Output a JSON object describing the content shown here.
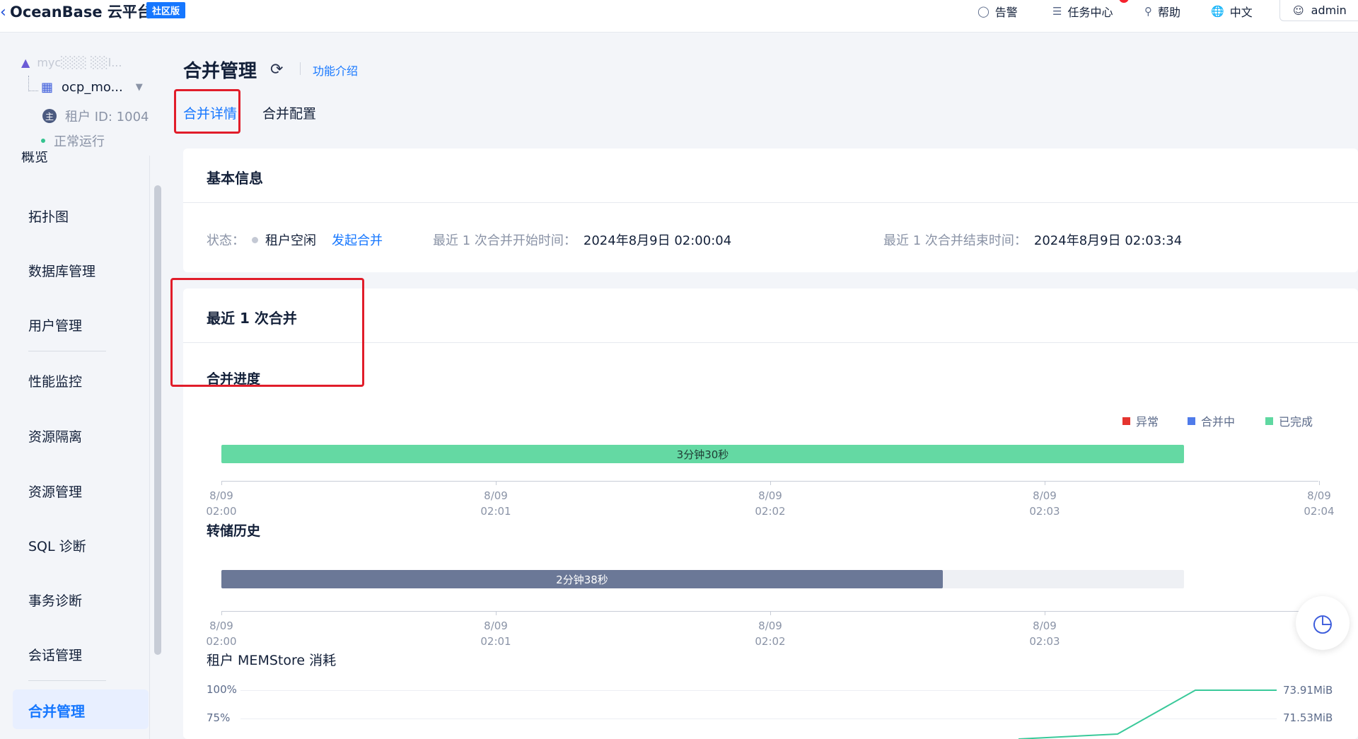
{
  "topbar": {
    "brand": "OceanBase 云平台",
    "edition": "社区版",
    "alerts": "告警",
    "tasks": "任务中心",
    "help": "帮助",
    "language": "中文",
    "user": "admin"
  },
  "context": {
    "cluster": "myc░░░ ░░l...",
    "tenant": "ocp_mo...",
    "tenant_id": "租户 ID: 1004",
    "status": "正常运行"
  },
  "sidebar": {
    "items": [
      "概览",
      "拓扑图",
      "数据库管理",
      "用户管理",
      "性能监控",
      "资源隔离",
      "资源管理",
      "SQL 诊断",
      "事务诊断",
      "会话管理",
      "合并管理"
    ],
    "active": "合并管理"
  },
  "page": {
    "title": "合并管理",
    "intro_link": "功能介绍",
    "tabs": [
      "合并详情",
      "合并配置"
    ]
  },
  "basic_info": {
    "title": "基本信息",
    "status_label": "状态：",
    "status_value": "租户空闲",
    "action": "发起合并",
    "last_start_label": "最近 1 次合并开始时间：",
    "last_start_value": "2024年8月9日 02:00:04",
    "last_end_label": "最近 1 次合并结束时间：",
    "last_end_value": "2024年8月9日 02:03:34"
  },
  "last_merge": {
    "title": "最近 1 次合并",
    "progress_title": "合并进度",
    "legend": [
      {
        "name": "异常",
        "color": "#e5342f"
      },
      {
        "name": "合并中",
        "color": "#4f7bea"
      },
      {
        "name": "已完成",
        "color": "#5fd8a1"
      }
    ],
    "progress_bar_label": "3分钟30秒",
    "dump_title": "转储历史",
    "dump_bar_label": "2分钟38秒",
    "memstore_title": "租户 MEMStore 消耗"
  },
  "chart_data": [
    {
      "type": "bar",
      "x_ticks": [
        [
          "8/09",
          "02:00"
        ],
        [
          "8/09",
          "02:01"
        ],
        [
          "8/09",
          "02:02"
        ],
        [
          "8/09",
          "02:03"
        ],
        [
          "8/09",
          "02:04"
        ]
      ],
      "bar": {
        "start": "02:00:04",
        "end": "02:03:34",
        "label": "3分钟30秒",
        "color": "#5fd8a1"
      }
    },
    {
      "type": "bar",
      "x_ticks": [
        [
          "8/09",
          "02:00"
        ],
        [
          "8/09",
          "02:01"
        ],
        [
          "8/09",
          "02:02"
        ],
        [
          "8/09",
          "02:03"
        ]
      ],
      "bar": {
        "label": "2分钟38秒",
        "color": "#6b7897"
      }
    },
    {
      "type": "line",
      "y_ticks": [
        "100%",
        "75%"
      ],
      "right_labels": [
        "73.91MiB",
        "71.53MiB"
      ],
      "line_color": "#3ac99a"
    }
  ],
  "colors": {
    "accent": "#1677ff",
    "highlight": "#e11d2a"
  }
}
